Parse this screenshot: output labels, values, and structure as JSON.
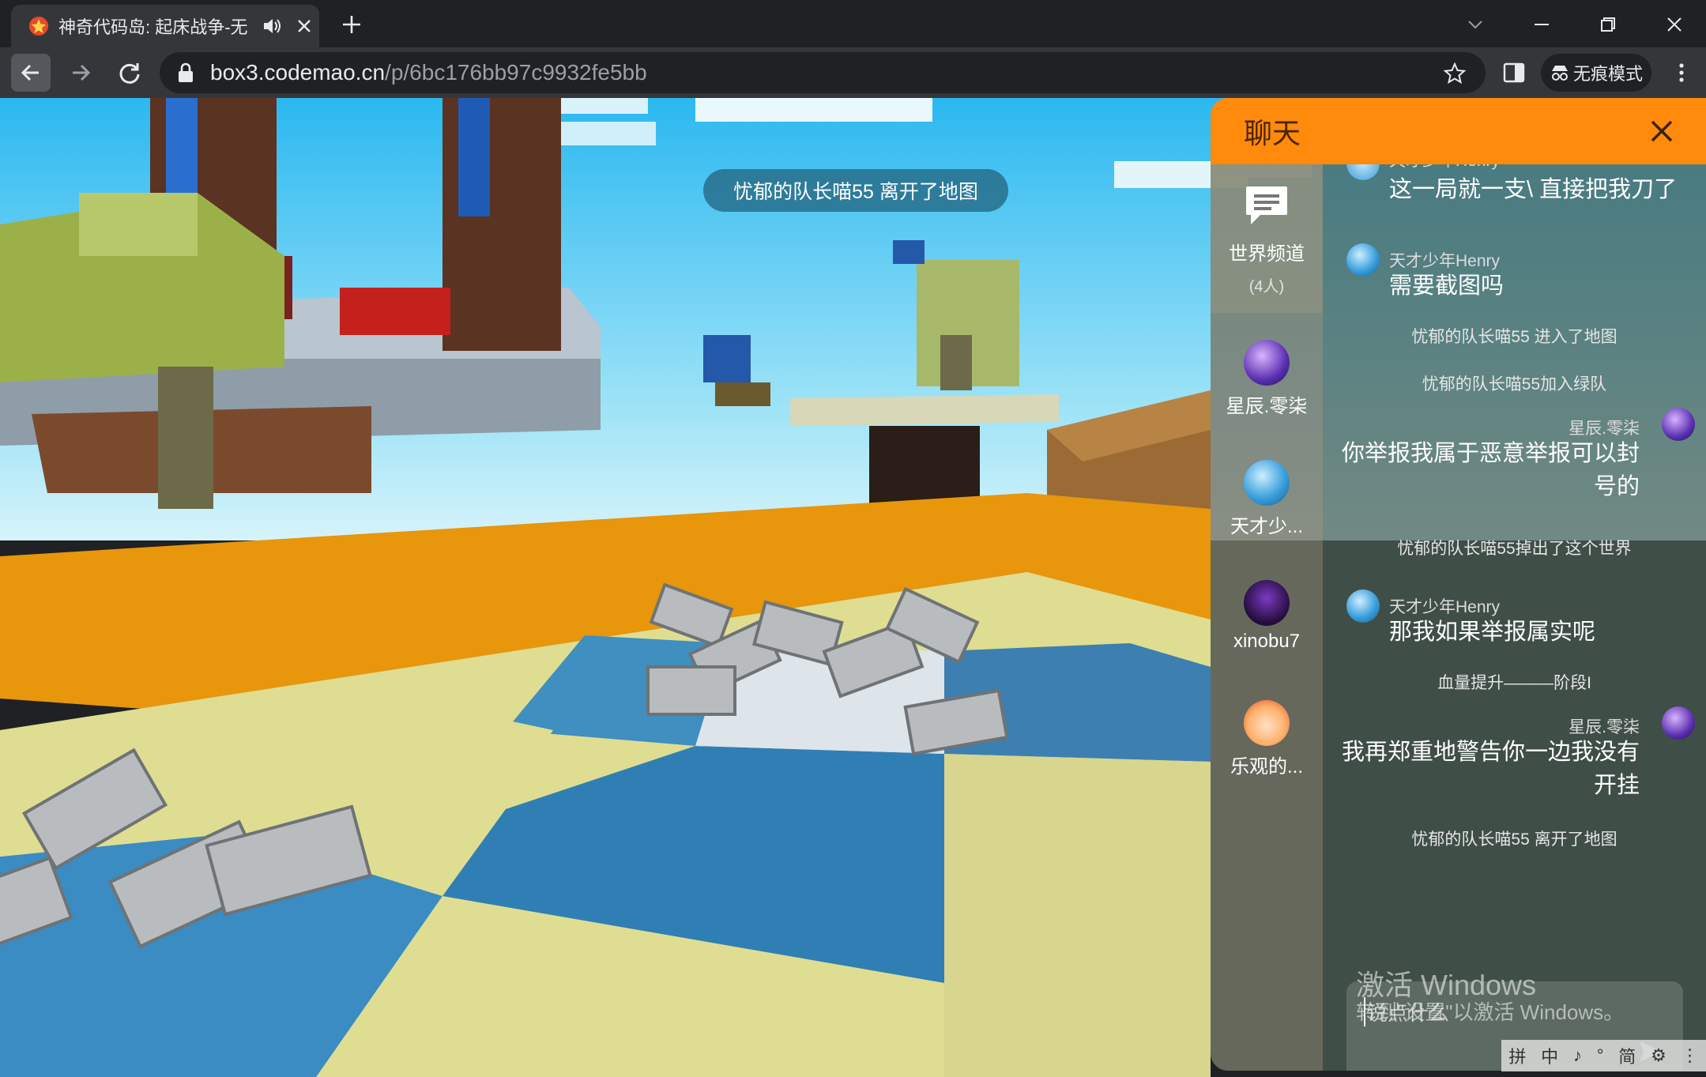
{
  "browser": {
    "tab_title": "神奇代码岛: 起床战争-无",
    "url_host": "box3.codemao.cn",
    "url_path": "/p/6bc176bb97c9932fe5bb",
    "incognito_label": "无痕模式"
  },
  "game": {
    "toast": "忧郁的队长喵55 离开了地图"
  },
  "chat": {
    "title": "聊天",
    "channels": [
      {
        "label": "世界频道",
        "count": "(4人)",
        "icon": "chat-bubble-icon"
      },
      {
        "label": "星辰.零柒",
        "icon": "avatar-purple-planet"
      },
      {
        "label": "天才少...",
        "icon": "avatar-blue-sphere"
      },
      {
        "label": "xinobu7",
        "icon": "avatar-dark-character"
      },
      {
        "label": "乐观的...",
        "icon": "avatar-anime-girl"
      }
    ],
    "messages": [
      {
        "name": "天才少年Henry",
        "text": "这一局就一支\\ 直接把我刀了"
      },
      {
        "name": "天才少年Henry",
        "text": "需要截图吗"
      },
      {
        "system": "忧郁的队长喵55 进入了地图"
      },
      {
        "system": "忧郁的队长喵55加入绿队"
      },
      {
        "name": "星辰.零柒",
        "text_line1": "你举报我属于恶意举报可以封",
        "text_line2": "号的"
      },
      {
        "system": "忧郁的队长喵55掉出了这个世界"
      },
      {
        "name": "天才少年Henry",
        "text": "那我如果举报属实呢"
      },
      {
        "system": "血量提升———阶段I"
      },
      {
        "name": "星辰.零柒",
        "text_line1": "我再郑重地警告你一边我没有",
        "text_line2": "开挂"
      },
      {
        "system": "忧郁的队长喵55 离开了地图"
      }
    ],
    "input_placeholder": "说点什么"
  },
  "os": {
    "watermark_line1": "激活 Windows",
    "watermark_line2": "转到\"设置\"以激活 Windows。",
    "ime_items": [
      "拼",
      "中",
      "♪",
      "°",
      "简",
      "⚙",
      "⋮"
    ]
  },
  "colors": {
    "chat_header": "#ff8a0c",
    "sky_top": "#2bb8f0",
    "floor_yellow": "#dedd92",
    "floor_blue": "#2f7fb5",
    "orange_trim": "#e8960c"
  }
}
